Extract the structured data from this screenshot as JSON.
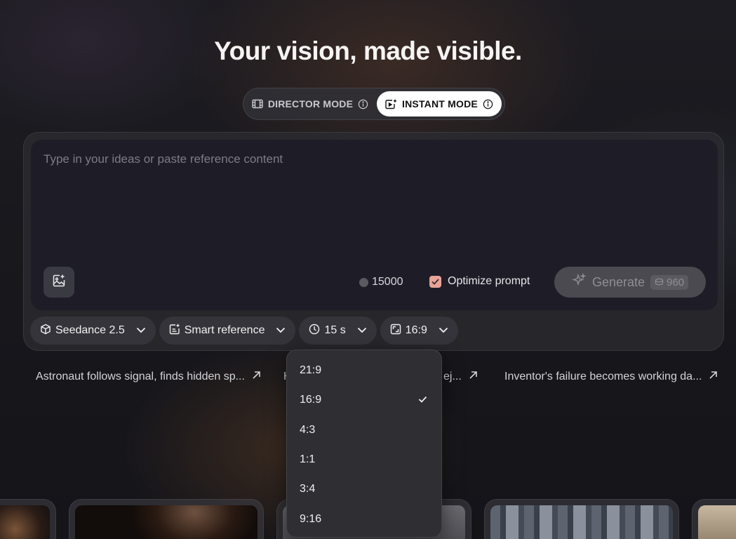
{
  "headline": "Your vision, made visible.",
  "modes": {
    "director": {
      "label": "DIRECTOR MODE"
    },
    "instant": {
      "label": "INSTANT MODE",
      "active": true
    }
  },
  "composer": {
    "placeholder": "Type in your ideas or paste reference content",
    "credits": "15000",
    "optimize_label": "Optimize prompt",
    "optimize_checked": true,
    "generate_label": "Generate",
    "generate_cost": "960"
  },
  "options": {
    "model": "Seedance 2.5",
    "reference": "Smart reference",
    "duration": "15 s",
    "ratio": "16:9"
  },
  "suggestions": [
    {
      "text": "Astronaut follows signal, finds hidden sp..."
    },
    {
      "text": "H"
    },
    {
      "text": "ej..."
    },
    {
      "text": "Inventor's failure becomes working da..."
    }
  ],
  "ratio_menu": {
    "options": [
      "21:9",
      "16:9",
      "4:3",
      "1:1",
      "3:4",
      "9:16"
    ],
    "selected": "16:9"
  },
  "colors": {
    "accent_checkbox": "#e9a49a",
    "editor_bg": "#1e1d27",
    "chip_bg": "#34343a",
    "dropdown_bg": "#2e2e33"
  },
  "icons": {
    "director": "film-icon",
    "instant": "video-sparkle-icon",
    "info": "info-icon",
    "upload": "image-plus-icon",
    "generate": "sparkle-icon",
    "cost": "coin-stack-icon",
    "model": "cube-icon",
    "reference": "doc-sparkle-icon",
    "duration": "clock-icon",
    "ratio": "aspect-ratio-icon",
    "chevron": "chevron-down-icon",
    "arrow": "arrow-up-right-icon",
    "check": "check-icon"
  }
}
